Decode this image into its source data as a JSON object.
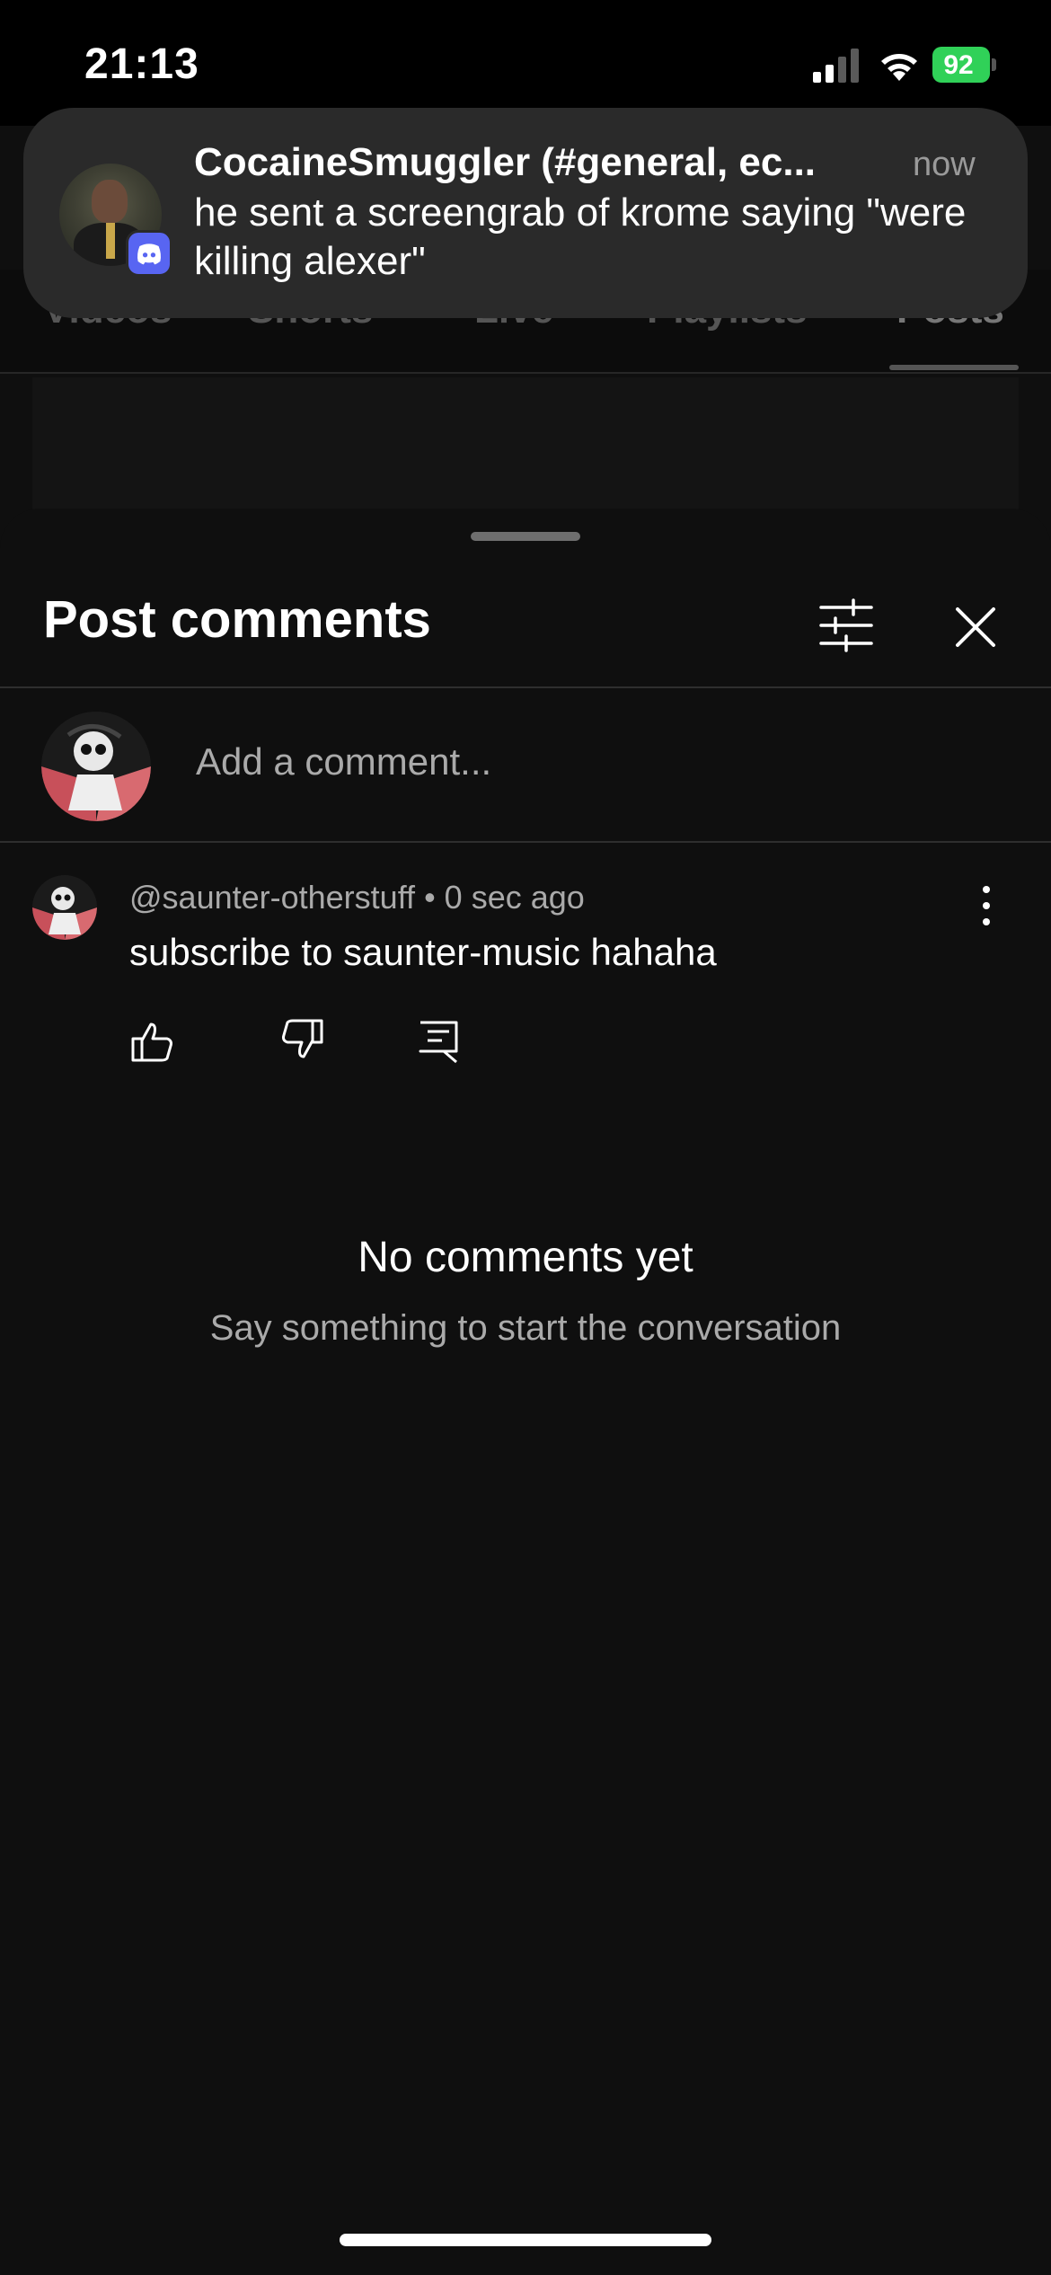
{
  "status_bar": {
    "time": "21:13",
    "battery": "92",
    "icons": [
      "signal-icon",
      "wifi-icon",
      "battery-icon"
    ]
  },
  "background_tabs": [
    "Videos",
    "Shorts",
    "Live",
    "Playlists",
    "Posts"
  ],
  "notification": {
    "title": "CocaineSmuggler (#general, ec...",
    "time": "now",
    "body": "he sent a screengrab of krome saying \"were killing alexer\"",
    "app_icon": "discord-icon"
  },
  "comments_sheet": {
    "title": "Post comments",
    "input_placeholder": "Add a comment...",
    "comments": [
      {
        "author": "@saunter-otherstuff",
        "time": "0 sec ago",
        "text": "subscribe to saunter-music hahaha"
      }
    ],
    "empty_title": "No comments yet",
    "empty_subtitle": "Say something to start the conversation"
  },
  "colors": {
    "background": "#0f0f0f",
    "notification_bg": "#2a2a2a",
    "discord_brand": "#5865f2",
    "battery_green": "#30d158"
  }
}
